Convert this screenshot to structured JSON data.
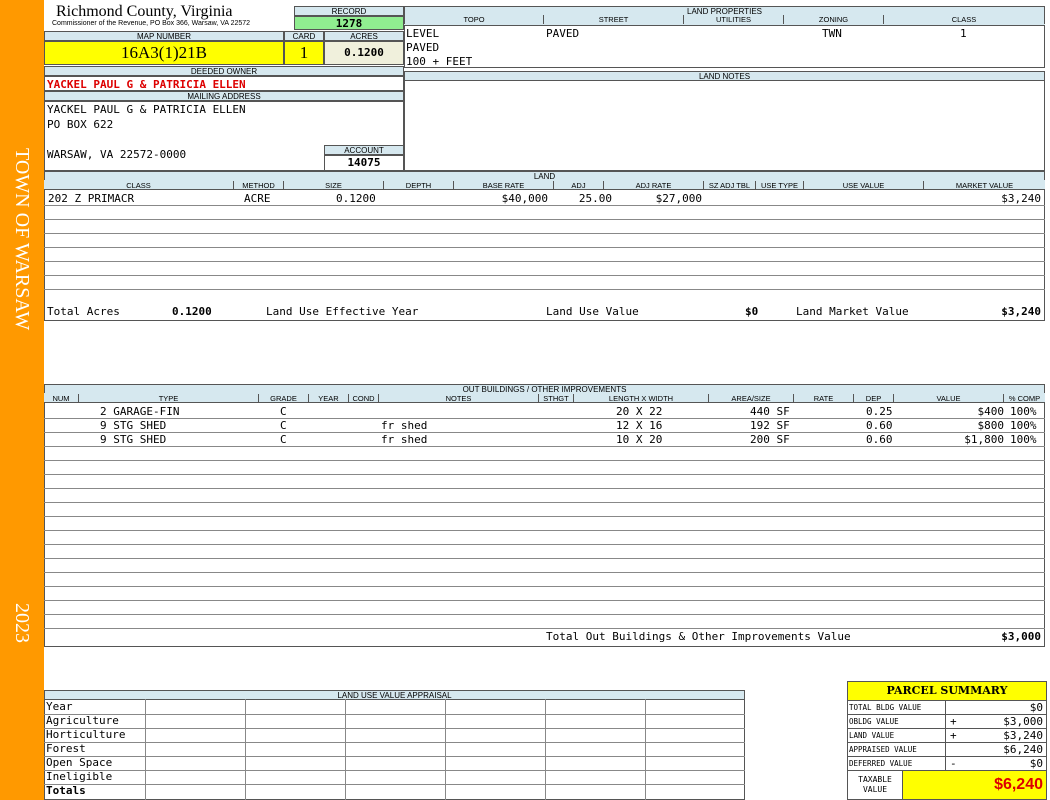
{
  "sidebar": {
    "town": "TOWN OF WARSAW",
    "year": "2023"
  },
  "header": {
    "county": "Richmond County, Virginia",
    "commissioner": "Commissioner of the Revenue, PO Box 366, Warsaw, VA 22572",
    "record_label": "RECORD",
    "record": "1278",
    "map_label": "MAP NUMBER",
    "map_number": "16A3(1)21B",
    "card_label": "CARD",
    "card": "1",
    "acres_label": "ACRES",
    "acres": "0.1200"
  },
  "owner": {
    "deeded_label": "DEEDED OWNER",
    "deeded": "YACKEL PAUL G & PATRICIA ELLEN",
    "mailing_label": "MAILING ADDRESS",
    "address": [
      "YACKEL PAUL G & PATRICIA ELLEN",
      "PO BOX 622",
      "",
      "WARSAW, VA 22572-0000"
    ],
    "account_label": "ACCOUNT",
    "account": "14075"
  },
  "land_properties": {
    "title": "LAND PROPERTIES",
    "columns": [
      "TOPO",
      "STREET",
      "UTILITIES",
      "ZONING",
      "CLASS"
    ],
    "topo": [
      "LEVEL",
      "PAVED",
      "100 + FEET"
    ],
    "street": "PAVED",
    "zoning": "TWN",
    "class": "1"
  },
  "land_notes": {
    "title": "LAND NOTES"
  },
  "land": {
    "title": "LAND",
    "columns": [
      "CLASS",
      "METHOD",
      "SIZE",
      "DEPTH",
      "BASE RATE",
      "ADJ",
      "ADJ RATE",
      "SZ ADJ TBL",
      "USE TYPE",
      "USE VALUE",
      "MARKET VALUE"
    ],
    "rows": [
      {
        "class": "202 Z PRIMACR",
        "method": "ACRE",
        "size": "0.1200",
        "depth": "",
        "base_rate": "$40,000",
        "adj": "25.00",
        "adj_rate": "$27,000",
        "sz_adj": "",
        "use_type": "",
        "use_value": "",
        "market_value": "$3,240"
      }
    ],
    "total_acres_label": "Total Acres",
    "total_acres": "0.1200",
    "effective_year_label": "Land Use Effective Year",
    "use_value_label": "Land Use Value",
    "use_value": "$0",
    "market_value_label": "Land Market Value",
    "market_value": "$3,240"
  },
  "outbuildings": {
    "title": "OUT BUILDINGS / OTHER IMPROVEMENTS",
    "columns": [
      "NUM",
      "TYPE",
      "GRADE",
      "YEAR",
      "COND",
      "NOTES",
      "STHGT",
      "LENGTH X WIDTH",
      "AREA/SIZE",
      "RATE",
      "DEP",
      "VALUE",
      "% COMP"
    ],
    "rows": [
      {
        "type": "2 GARAGE-FIN",
        "grade": "C",
        "notes": "",
        "lw": "20 X 22",
        "area": "440 SF",
        "dep": "0.25",
        "value": "$400",
        "comp": "100%"
      },
      {
        "type": "9 STG SHED",
        "grade": "C",
        "notes": "fr shed",
        "lw": "12 X 16",
        "area": "192 SF",
        "dep": "0.60",
        "value": "$800",
        "comp": "100%"
      },
      {
        "type": "9 STG SHED",
        "grade": "C",
        "notes": "fr shed",
        "lw": "10 X 20",
        "area": "200 SF",
        "dep": "0.60",
        "value": "$1,800",
        "comp": "100%"
      }
    ],
    "total_label": "Total Out Buildings & Other Improvements Value",
    "total": "$3,000"
  },
  "land_use": {
    "title": "LAND USE VALUE APPRAISAL",
    "rows": [
      "Year",
      "Agriculture",
      "Horticulture",
      "Forest",
      "Open Space",
      "Ineligible",
      "Totals"
    ]
  },
  "summary": {
    "title": "PARCEL SUMMARY",
    "rows": [
      {
        "label": "TOTAL BLDG VALUE",
        "sign": "",
        "value": "$0"
      },
      {
        "label": "OBLDG VALUE",
        "sign": "+",
        "value": "$3,000"
      },
      {
        "label": "LAND VALUE",
        "sign": "+",
        "value": "$3,240"
      },
      {
        "label": "APPRAISED VALUE",
        "sign": "",
        "value": "$6,240"
      },
      {
        "label": "DEFERRED VALUE",
        "sign": "-",
        "value": "$0"
      }
    ],
    "taxable_label": [
      "TAXABLE",
      "VALUE"
    ],
    "taxable": "$6,240"
  },
  "colors": {
    "sidebar": "#ff9900",
    "header_bg": "#d6e8ef",
    "highlight": "#ffff00",
    "record_bg": "#90ee90",
    "owner_red": "#dd0000"
  }
}
